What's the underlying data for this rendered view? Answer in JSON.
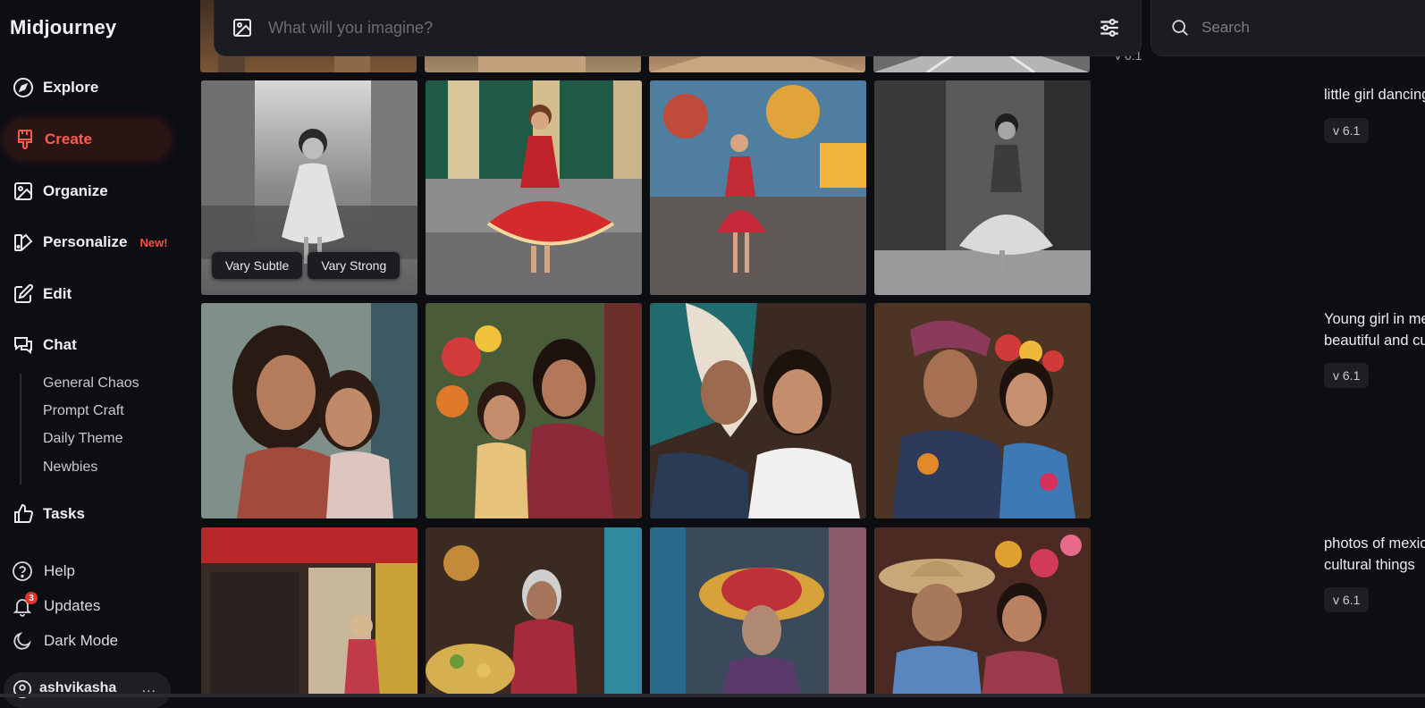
{
  "app": {
    "title": "Midjourney"
  },
  "nav": {
    "explore": "Explore",
    "create": "Create",
    "organize": "Organize",
    "personalize": "Personalize",
    "personalize_badge": "New!",
    "edit": "Edit",
    "chat": "Chat",
    "chat_rooms": [
      "General Chaos",
      "Prompt Craft",
      "Daily Theme",
      "Newbies"
    ],
    "tasks": "Tasks"
  },
  "footer": {
    "help": "Help",
    "updates": "Updates",
    "updates_count": "3",
    "dark_mode": "Dark Mode",
    "username": "ashvikasha",
    "more": "..."
  },
  "topbar": {
    "imagine_placeholder": "What will you imagine?",
    "search_placeholder": "Search"
  },
  "feed": {
    "top_version": "v 6.1",
    "rows": [
      {
        "prompt": "little girl dancing in mexico city",
        "version": "v 6.1"
      },
      {
        "prompt": "Young girl in mexico city with her mom, beautiful and cultural, photography",
        "version": "v 6.1"
      },
      {
        "prompt": "photos of mexico city and people and cultural things",
        "version": "v 6.1"
      }
    ],
    "vary_subtle": "Vary Subtle",
    "vary_strong": "Vary Strong"
  },
  "colors": {
    "accent": "#ff5a4a",
    "background": "#0d0e12",
    "panel": "#1b1c21"
  },
  "icons": [
    "compass-icon",
    "brush-icon",
    "image-icon",
    "personalize-icon",
    "edit-icon",
    "chat-icon",
    "thumbs-up-icon",
    "help-icon",
    "bell-icon",
    "moon-icon",
    "sliders-icon",
    "search-icon"
  ]
}
